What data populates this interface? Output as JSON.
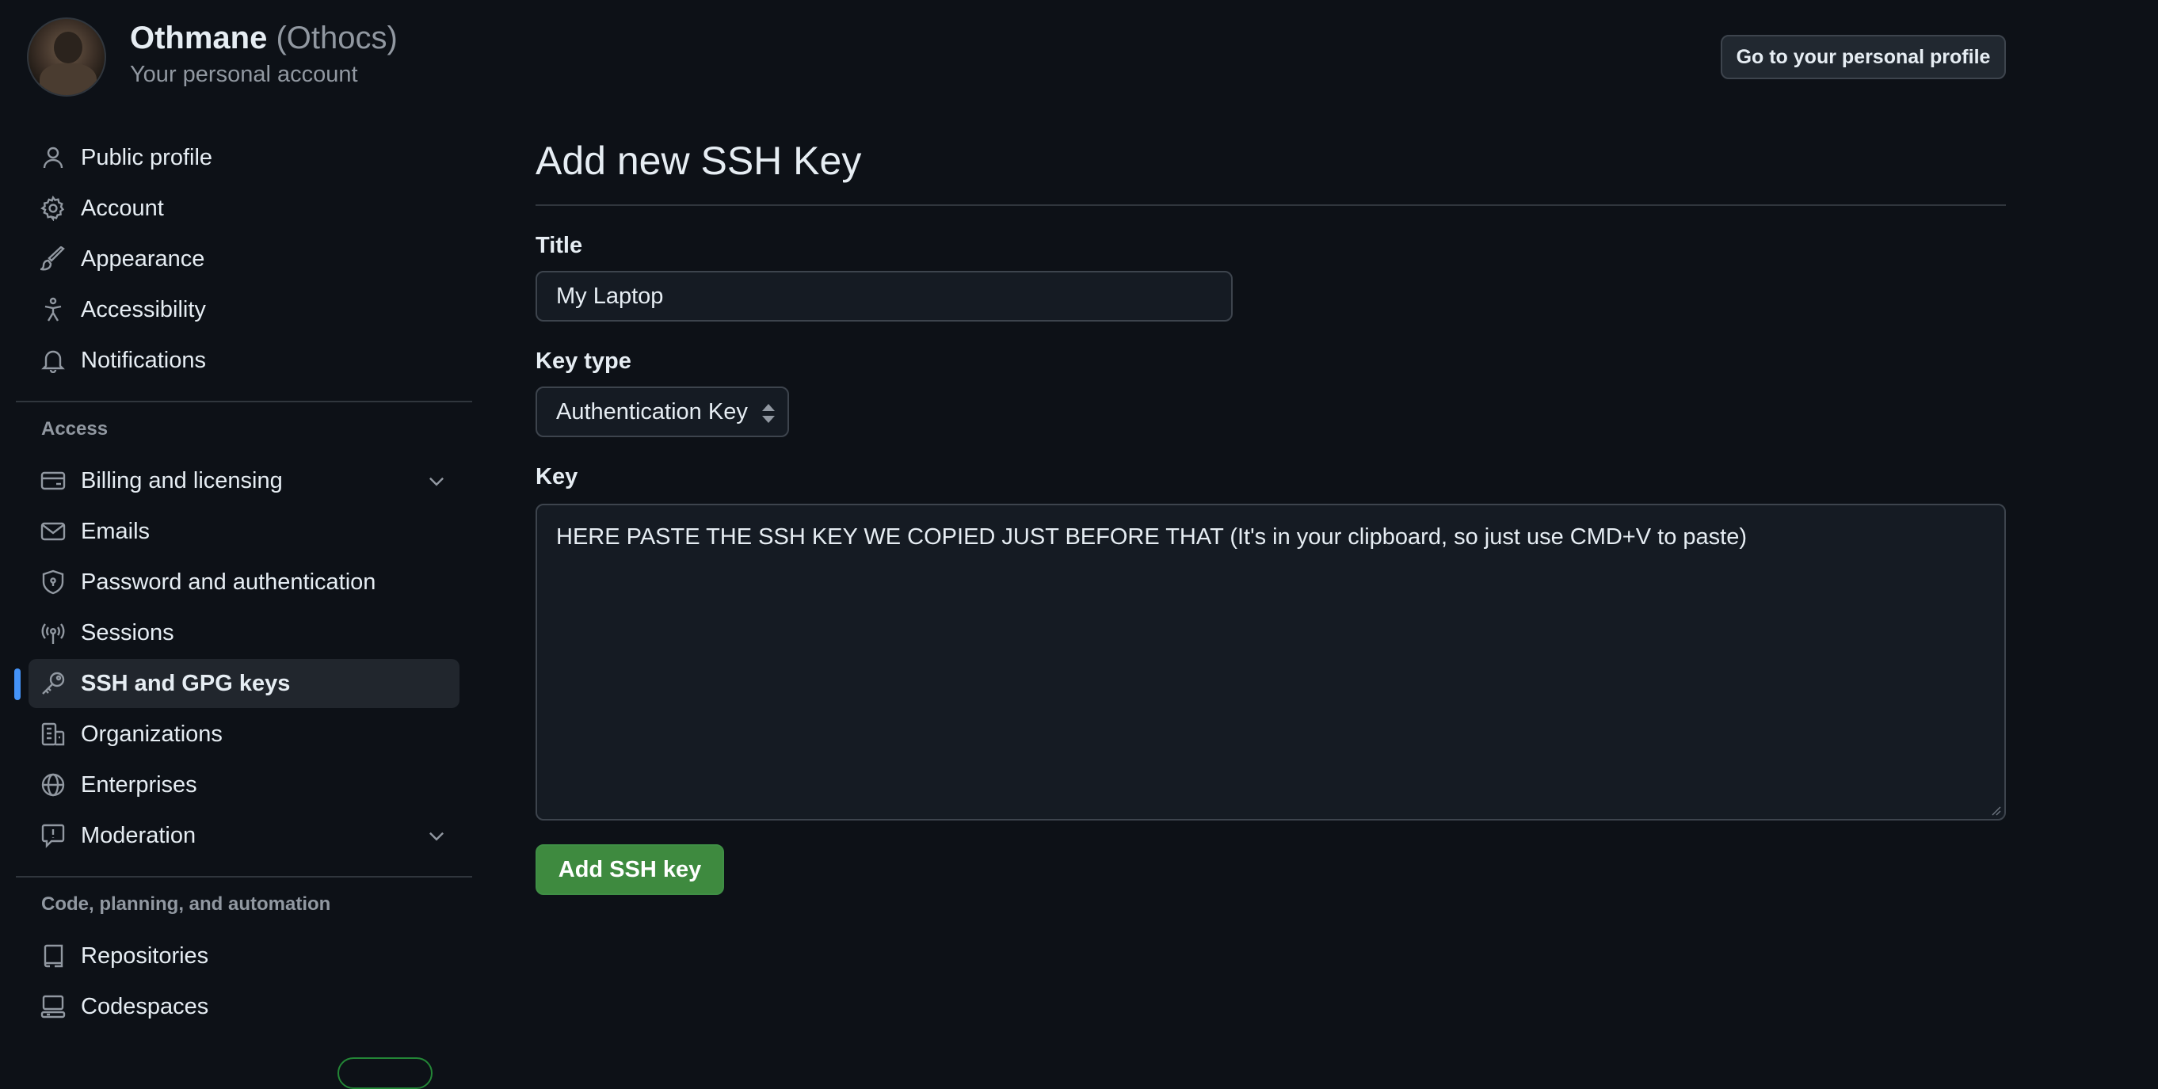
{
  "account": {
    "name": "Othmane",
    "handle": "(Othocs)",
    "subtitle": "Your personal account",
    "profile_button": "Go to your personal profile"
  },
  "sidebar": {
    "top_items": [
      {
        "label": "Public profile",
        "icon": "person-icon"
      },
      {
        "label": "Account",
        "icon": "gear-icon"
      },
      {
        "label": "Appearance",
        "icon": "paintbrush-icon"
      },
      {
        "label": "Accessibility",
        "icon": "accessibility-icon"
      },
      {
        "label": "Notifications",
        "icon": "bell-icon"
      }
    ],
    "access_label": "Access",
    "access_items": [
      {
        "label": "Billing and licensing",
        "icon": "credit-card-icon",
        "expandable": true
      },
      {
        "label": "Emails",
        "icon": "mail-icon"
      },
      {
        "label": "Password and authentication",
        "icon": "shield-lock-icon"
      },
      {
        "label": "Sessions",
        "icon": "broadcast-icon"
      },
      {
        "label": "SSH and GPG keys",
        "icon": "key-icon",
        "active": true
      },
      {
        "label": "Organizations",
        "icon": "organization-icon"
      },
      {
        "label": "Enterprises",
        "icon": "globe-icon"
      },
      {
        "label": "Moderation",
        "icon": "report-icon",
        "expandable": true
      }
    ],
    "code_label": "Code, planning, and automation",
    "code_items": [
      {
        "label": "Repositories",
        "icon": "repo-icon"
      },
      {
        "label": "Codespaces",
        "icon": "codespaces-icon"
      }
    ]
  },
  "form": {
    "page_title": "Add new SSH Key",
    "title_label": "Title",
    "title_value": "My Laptop",
    "key_type_label": "Key type",
    "key_type_value": "Authentication Key",
    "key_label": "Key",
    "key_value": "HERE PASTE THE SSH KEY WE COPIED JUST BEFORE THAT (It's in your clipboard, so just use CMD+V to paste)",
    "submit_label": "Add SSH key"
  },
  "colors": {
    "background": "#0d1117",
    "accent_blue": "#4493f8",
    "primary_green": "#3e8a3f"
  }
}
